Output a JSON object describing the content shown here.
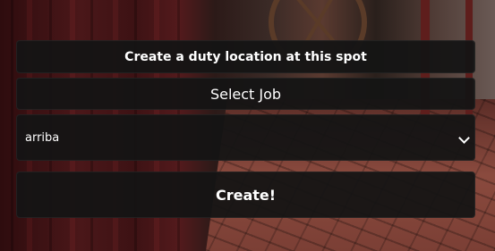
{
  "duty_menu": {
    "title": "Create a duty location at this spot",
    "select_job_label": "Select Job",
    "job_dropdown": {
      "selected": "arriba",
      "icon": "chevron-down-icon"
    },
    "create_label": "Create!"
  },
  "colors": {
    "panel_background": "#141414",
    "text": "#ffffff"
  }
}
